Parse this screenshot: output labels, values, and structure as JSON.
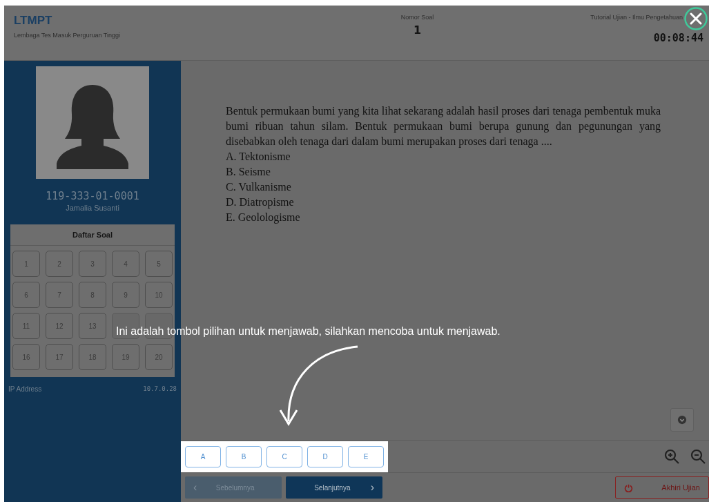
{
  "header": {
    "logo": "LTMPT",
    "subtitle": "Lembaga Tes Masuk Perguruan Tinggi",
    "question_label": "Nomor Soal",
    "question_number": "1",
    "exam_title": "Tutorial Ujian - Ilmu Pengetahuan",
    "timer": "00:08:44"
  },
  "participant": {
    "id": "119-333-01-0001",
    "name": "Jamalia Susanti"
  },
  "question_list": {
    "title": "Daftar Soal",
    "items": [
      {
        "number": "1"
      },
      {
        "number": "2"
      },
      {
        "number": "3"
      },
      {
        "number": "4"
      },
      {
        "number": "5"
      },
      {
        "number": "6"
      },
      {
        "number": "7"
      },
      {
        "number": "8"
      },
      {
        "number": "9"
      },
      {
        "number": "10"
      },
      {
        "number": "11"
      },
      {
        "number": "12"
      },
      {
        "number": "13"
      },
      {
        "covered": true
      },
      {
        "covered": true
      },
      {
        "number": "16"
      },
      {
        "number": "17"
      },
      {
        "number": "18"
      },
      {
        "number": "19"
      },
      {
        "number": "20"
      }
    ]
  },
  "ip": {
    "label": "IP Address",
    "value": "10.7.0.28"
  },
  "question": {
    "text": "Bentuk permukaan bumi yang kita lihat sekarang adalah hasil proses dari tenaga pembentuk muka bumi ribuan tahun silam. Bentuk permukaan bumi berupa gunung dan pegunungan yang disebabkan oleh tenaga dari dalam bumi merupakan proses dari tenaga ....",
    "options": [
      "A. Tektonisme",
      "B. Seisme",
      "C. Vulkanisme",
      "D. Diatropisme",
      "E. Geolologisme"
    ]
  },
  "answer_buttons": [
    "A",
    "B",
    "C",
    "D",
    "E"
  ],
  "navigation": [
    {
      "label": "Sebelumnya",
      "kind": "prev",
      "icon": "‹",
      "disabled": true
    },
    {
      "label": "Selanjutnya",
      "kind": "next",
      "icon": "›",
      "disabled": false
    }
  ],
  "end_button": "Akhiri Ujian",
  "tutorial_hint": "Ini adalah tombol pilihan untuk menjawab, silahkan mencoba untuk menjawab."
}
